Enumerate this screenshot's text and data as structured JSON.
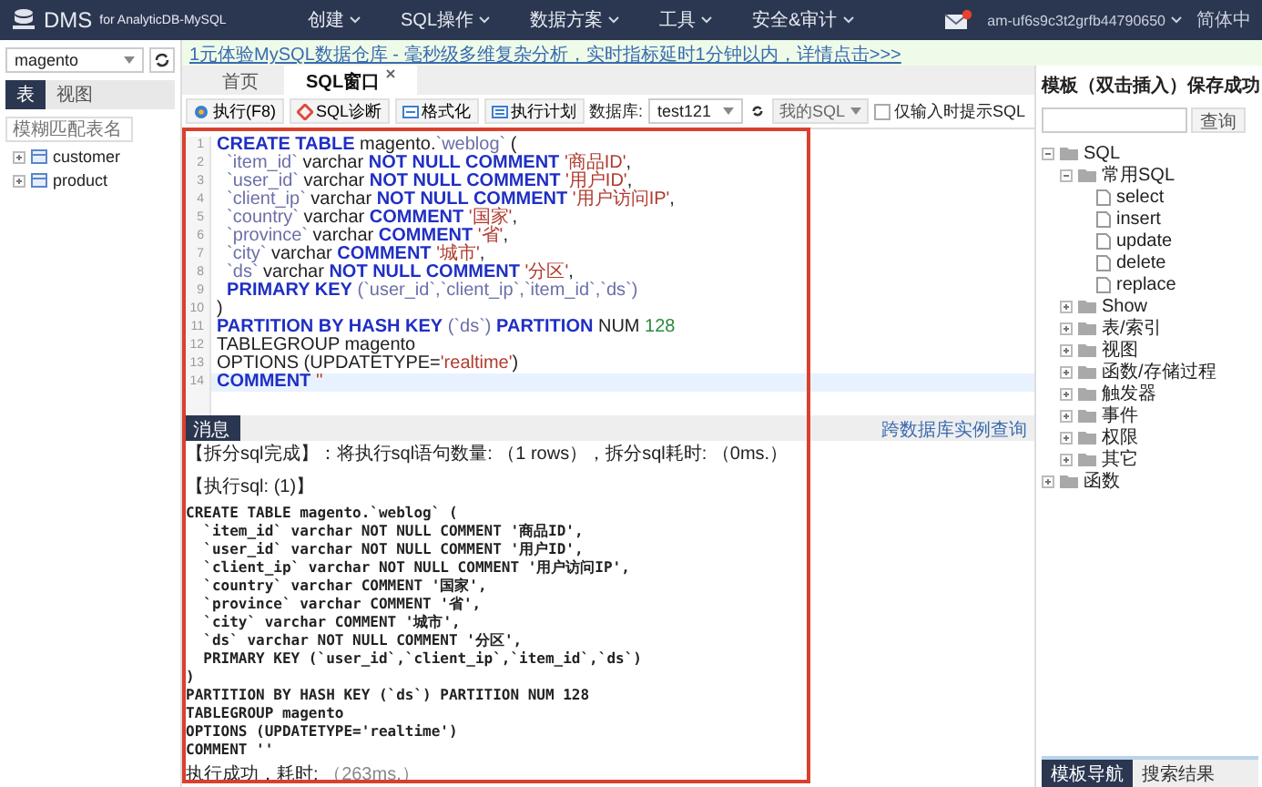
{
  "nav": {
    "logo": "DMS",
    "logo_sub": "for AnalyticDB-MySQL",
    "menus": [
      "创建",
      "SQL操作",
      "数据方案",
      "工具",
      "安全&审计"
    ],
    "has_unread": true,
    "account": "am-uf6s9c3t2grfb44790650",
    "language": "简体中"
  },
  "sidebar": {
    "database": "magento",
    "tabs": [
      {
        "label": "表",
        "selected": true
      },
      {
        "label": "视图",
        "selected": false
      }
    ],
    "search": {
      "placeholder": "模糊匹配表名"
    },
    "tables": [
      {
        "name": "customer"
      },
      {
        "name": "product"
      }
    ]
  },
  "notice": "1元体验MySQL数据仓库 - 毫秒级多维复杂分析，实时指标延时1分钟以内，详情点击>>>",
  "tabs": [
    {
      "label": "首页",
      "selected": false,
      "closable": false
    },
    {
      "label": "SQL窗口",
      "selected": true,
      "closable": true
    }
  ],
  "toolbar": {
    "buttons": [
      {
        "label": "执行(F8)",
        "kind": "run"
      },
      {
        "label": "SQL诊断",
        "kind": "diagnose"
      },
      {
        "label": "格式化",
        "kind": "format"
      },
      {
        "label": "执行计划",
        "kind": "plan"
      }
    ],
    "database_label": "数据库:",
    "database": "test121",
    "saved_sql": "我的SQL",
    "hint_checkbox": {
      "label": "仅输入时提示SQL",
      "checked": false
    }
  },
  "editor": {
    "lines": [
      {
        "no": "1",
        "current": false,
        "tokens": [
          {
            "kind": "keyword",
            "text": "CREATE TABLE"
          },
          {
            "kind": "plain",
            "text": " magento."
          },
          {
            "kind": "identifier",
            "text": "`weblog`"
          },
          {
            "kind": "plain",
            "text": " ("
          }
        ]
      },
      {
        "no": "2",
        "current": false,
        "tokens": [
          {
            "kind": "identifier",
            "text": "  `item_id`"
          },
          {
            "kind": "plain",
            "text": " varchar "
          },
          {
            "kind": "keyword",
            "text": "NOT NULL COMMENT"
          },
          {
            "kind": "string",
            "text": " '商品ID'"
          },
          {
            "kind": "plain",
            "text": ","
          }
        ]
      },
      {
        "no": "3",
        "current": false,
        "tokens": [
          {
            "kind": "identifier",
            "text": "  `user_id`"
          },
          {
            "kind": "plain",
            "text": " varchar "
          },
          {
            "kind": "keyword",
            "text": "NOT NULL COMMENT"
          },
          {
            "kind": "string",
            "text": " '用户ID'"
          },
          {
            "kind": "plain",
            "text": ","
          }
        ]
      },
      {
        "no": "4",
        "current": false,
        "tokens": [
          {
            "kind": "identifier",
            "text": "  `client_ip`"
          },
          {
            "kind": "plain",
            "text": " varchar "
          },
          {
            "kind": "keyword",
            "text": "NOT NULL COMMENT"
          },
          {
            "kind": "string",
            "text": " '用户访问IP'"
          },
          {
            "kind": "plain",
            "text": ","
          }
        ]
      },
      {
        "no": "5",
        "current": false,
        "tokens": [
          {
            "kind": "identifier",
            "text": "  `country`"
          },
          {
            "kind": "plain",
            "text": " varchar "
          },
          {
            "kind": "keyword",
            "text": "COMMENT"
          },
          {
            "kind": "string",
            "text": " '国家'"
          },
          {
            "kind": "plain",
            "text": ","
          }
        ]
      },
      {
        "no": "6",
        "current": false,
        "tokens": [
          {
            "kind": "identifier",
            "text": "  `province`"
          },
          {
            "kind": "plain",
            "text": " varchar "
          },
          {
            "kind": "keyword",
            "text": "COMMENT"
          },
          {
            "kind": "string",
            "text": " '省'"
          },
          {
            "kind": "plain",
            "text": ","
          }
        ]
      },
      {
        "no": "7",
        "current": false,
        "tokens": [
          {
            "kind": "identifier",
            "text": "  `city`"
          },
          {
            "kind": "plain",
            "text": " varchar "
          },
          {
            "kind": "keyword",
            "text": "COMMENT"
          },
          {
            "kind": "string",
            "text": " '城市'"
          },
          {
            "kind": "plain",
            "text": ","
          }
        ]
      },
      {
        "no": "8",
        "current": false,
        "tokens": [
          {
            "kind": "identifier",
            "text": "  `ds`"
          },
          {
            "kind": "plain",
            "text": " varchar "
          },
          {
            "kind": "keyword",
            "text": "NOT NULL COMMENT"
          },
          {
            "kind": "string",
            "text": " '分区'"
          },
          {
            "kind": "plain",
            "text": ","
          }
        ]
      },
      {
        "no": "9",
        "current": false,
        "tokens": [
          {
            "kind": "keyword",
            "text": "  PRIMARY KEY"
          },
          {
            "kind": "identifier",
            "text": " (`user_id`,`client_ip`,`item_id`,`ds`)"
          }
        ]
      },
      {
        "no": "10",
        "current": false,
        "tokens": [
          {
            "kind": "plain",
            "text": ")"
          }
        ]
      },
      {
        "no": "11",
        "current": false,
        "tokens": [
          {
            "kind": "keyword",
            "text": "PARTITION BY HASH KEY"
          },
          {
            "kind": "identifier",
            "text": " (`ds`) "
          },
          {
            "kind": "keyword",
            "text": "PARTITION"
          },
          {
            "kind": "plain",
            "text": " NUM "
          },
          {
            "kind": "number",
            "text": "128"
          }
        ]
      },
      {
        "no": "12",
        "current": false,
        "tokens": [
          {
            "kind": "plain",
            "text": "TABLEGROUP magento"
          }
        ]
      },
      {
        "no": "13",
        "current": false,
        "tokens": [
          {
            "kind": "plain",
            "text": "OPTIONS (UPDATETYPE="
          },
          {
            "kind": "string",
            "text": "'realtime'"
          },
          {
            "kind": "plain",
            "text": ")"
          }
        ]
      },
      {
        "no": "14",
        "current": true,
        "tokens": [
          {
            "kind": "keyword",
            "text": "COMMENT"
          },
          {
            "kind": "string",
            "text": " ''"
          }
        ]
      }
    ]
  },
  "messages": {
    "tab": "消息",
    "link": "跨数据库实例查询",
    "entries": [
      {
        "kind": "summary",
        "text": "【拆分sql完成】：将执行sql语句数量: （1 rows），拆分sql耗时: （0ms.）"
      },
      {
        "kind": "header",
        "text": "【执行sql: (1)】"
      },
      {
        "kind": "sql",
        "text": "CREATE TABLE magento.`weblog` ("
      },
      {
        "kind": "sql",
        "text": "  `item_id` varchar NOT NULL COMMENT '商品ID',"
      },
      {
        "kind": "sql",
        "text": "  `user_id` varchar NOT NULL COMMENT '用户ID',"
      },
      {
        "kind": "sql",
        "text": "  `client_ip` varchar NOT NULL COMMENT '用户访问IP',"
      },
      {
        "kind": "sql",
        "text": "  `country` varchar COMMENT '国家',"
      },
      {
        "kind": "sql",
        "text": "  `province` varchar COMMENT '省',"
      },
      {
        "kind": "sql",
        "text": "  `city` varchar COMMENT '城市',"
      },
      {
        "kind": "sql",
        "text": "  `ds` varchar NOT NULL COMMENT '分区',"
      },
      {
        "kind": "sql",
        "text": "  PRIMARY KEY (`user_id`,`client_ip`,`item_id`,`ds`)"
      },
      {
        "kind": "sql",
        "text": ")"
      },
      {
        "kind": "sql",
        "text": "PARTITION BY HASH KEY (`ds`) PARTITION NUM 128"
      },
      {
        "kind": "sql",
        "text": "TABLEGROUP magento"
      },
      {
        "kind": "sql",
        "text": "OPTIONS (UPDATETYPE='realtime')"
      },
      {
        "kind": "sql",
        "text": "COMMENT ''"
      },
      {
        "kind": "result",
        "text": "执行成功，耗时:",
        "detail": "（263ms.）"
      }
    ]
  },
  "annotation_frame": true,
  "templates": {
    "title": "模板（双击插入）保存成功",
    "search_button": "查询",
    "tree": [
      {
        "label": "SQL",
        "kind": "folder",
        "expanded": true,
        "children": [
          {
            "label": "常用SQL",
            "kind": "folder",
            "expanded": true,
            "children": [
              {
                "label": "select",
                "kind": "file"
              },
              {
                "label": "insert",
                "kind": "file"
              },
              {
                "label": "update",
                "kind": "file"
              },
              {
                "label": "delete",
                "kind": "file"
              },
              {
                "label": "replace",
                "kind": "file"
              }
            ]
          },
          {
            "label": "Show",
            "kind": "folder",
            "expanded": false
          },
          {
            "label": "表/索引",
            "kind": "folder",
            "expanded": false
          },
          {
            "label": "视图",
            "kind": "folder",
            "expanded": false
          },
          {
            "label": "函数/存储过程",
            "kind": "folder",
            "expanded": false
          },
          {
            "label": "触发器",
            "kind": "folder",
            "expanded": false
          },
          {
            "label": "事件",
            "kind": "folder",
            "expanded": false
          },
          {
            "label": "权限",
            "kind": "folder",
            "expanded": false
          },
          {
            "label": "其它",
            "kind": "folder",
            "expanded": false
          }
        ]
      },
      {
        "label": "函数",
        "kind": "folder",
        "expanded": false
      }
    ],
    "tabs": [
      {
        "label": "模板导航",
        "selected": true
      },
      {
        "label": "搜索结果",
        "selected": false
      }
    ]
  }
}
